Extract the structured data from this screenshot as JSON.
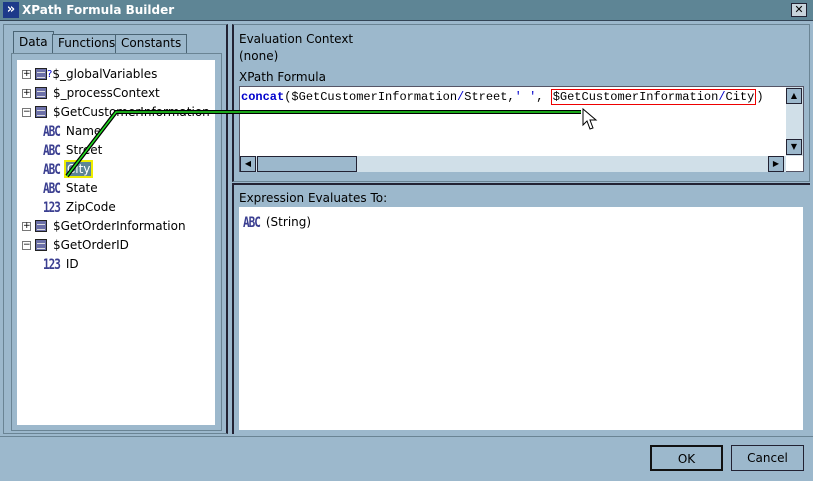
{
  "window": {
    "title": "XPath Formula Builder",
    "close": "✕"
  },
  "tabs": [
    {
      "label": "Data"
    },
    {
      "label": "Functions"
    },
    {
      "label": "Constants"
    }
  ],
  "tree": {
    "global": "$_globalVariables",
    "global_badge": "?",
    "process": "$_processContext",
    "customer": "$GetCustomerInformation",
    "customer_children": [
      {
        "label": "Name",
        "type": "ABC"
      },
      {
        "label": "Street",
        "type": "ABC"
      },
      {
        "label": "City",
        "type": "ABC"
      },
      {
        "label": "State",
        "type": "ABC"
      },
      {
        "label": "ZipCode",
        "type": "123"
      }
    ],
    "order": "$GetOrderInformation",
    "orderid": "$GetOrderID",
    "orderid_children": [
      {
        "label": "ID",
        "type": "123"
      }
    ],
    "plus": "+",
    "minus": "−"
  },
  "context": {
    "label": "Evaluation Context",
    "value": "(none)"
  },
  "formula": {
    "label": "XPath Formula",
    "fn": "concat",
    "p1": "($GetCustomerInformation",
    "s1": "/",
    "p2": "Street,",
    "str": "' '",
    "p3": ", ",
    "h1": "$GetCustomerInformation",
    "s2": "/",
    "h2": "City",
    "p4": ")"
  },
  "result": {
    "label": "Expression Evaluates To:",
    "type": "ABC",
    "value": "(String)"
  },
  "buttons": {
    "ok": "OK",
    "cancel": "Cancel"
  },
  "scroll": {
    "up": "▲",
    "down": "▼",
    "left": "◀",
    "right": "▶"
  }
}
